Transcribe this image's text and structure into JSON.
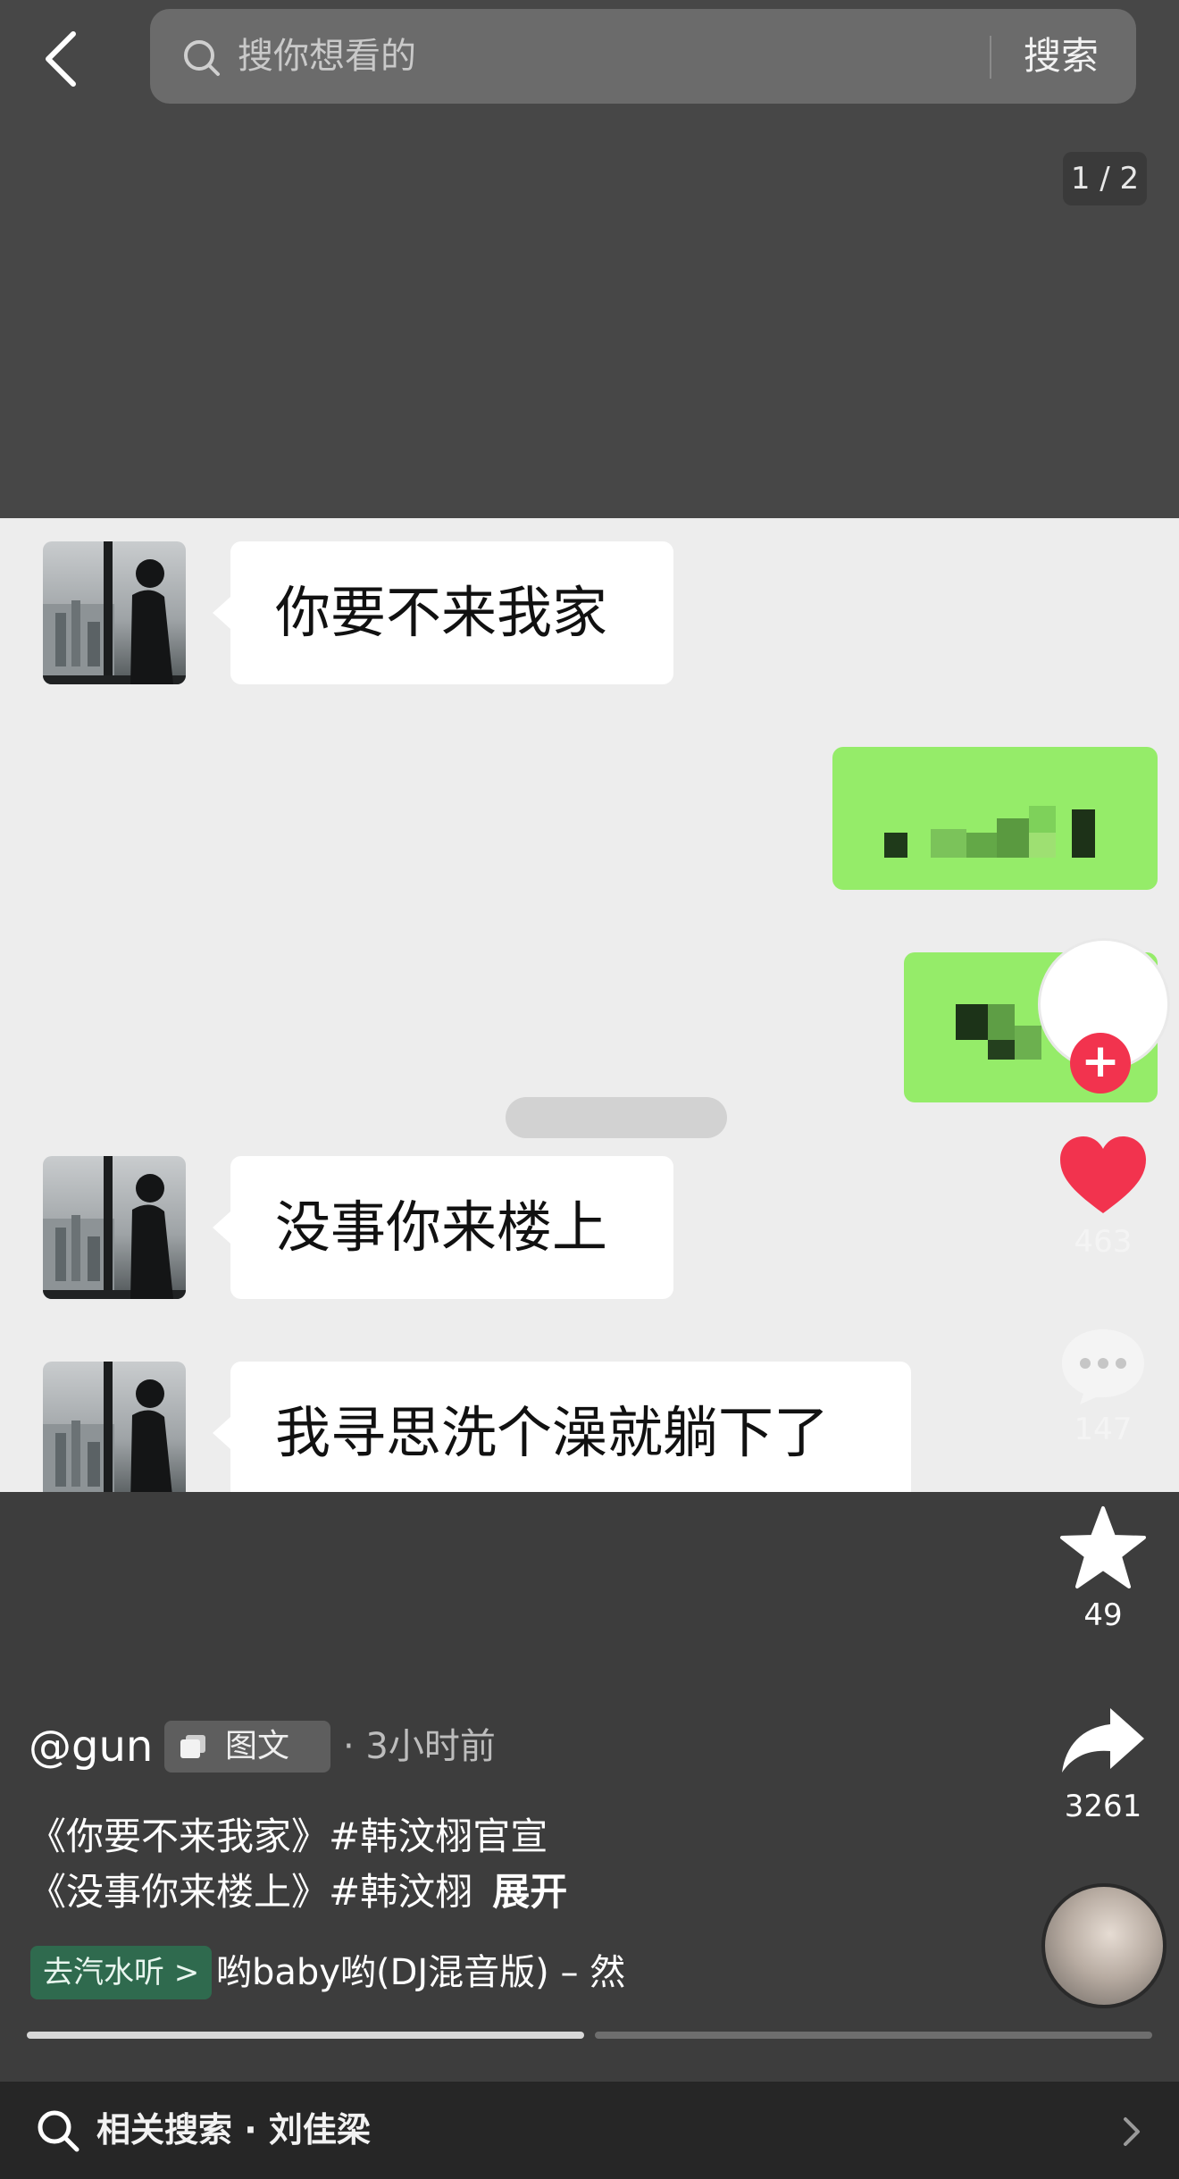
{
  "search": {
    "placeholder": "搜你想看的",
    "button_label": "搜索"
  },
  "page_indicator": "1 / 2",
  "chat": {
    "messages": [
      {
        "side": "left",
        "text": "你要不来我家"
      },
      {
        "side": "right",
        "text": ""
      },
      {
        "side": "right",
        "text": ""
      },
      {
        "side": "left",
        "text": "没事你来楼上"
      },
      {
        "side": "left",
        "text": "我寻思洗个澡就躺下了"
      }
    ]
  },
  "actions": {
    "likes": "463",
    "comments": "147",
    "favorites": "49",
    "shares": "3261"
  },
  "post": {
    "author": "@gun",
    "type_badge": "图文",
    "time": "· 3小时前",
    "desc_line1": "《你要不来我家》#韩汶栩官宣",
    "desc_line2": "《没事你来楼上》#韩汶栩",
    "expand_label": "展开"
  },
  "music": {
    "badge_label": "去汽水听 >",
    "title": "哟baby哟(DJ混音版) – 然"
  },
  "related": {
    "label": "相关搜索 · 刘佳梁"
  },
  "colors": {
    "bubble_green": "#95ec69",
    "like_red": "#f2334e",
    "music_badge": "#2f6a4e"
  }
}
